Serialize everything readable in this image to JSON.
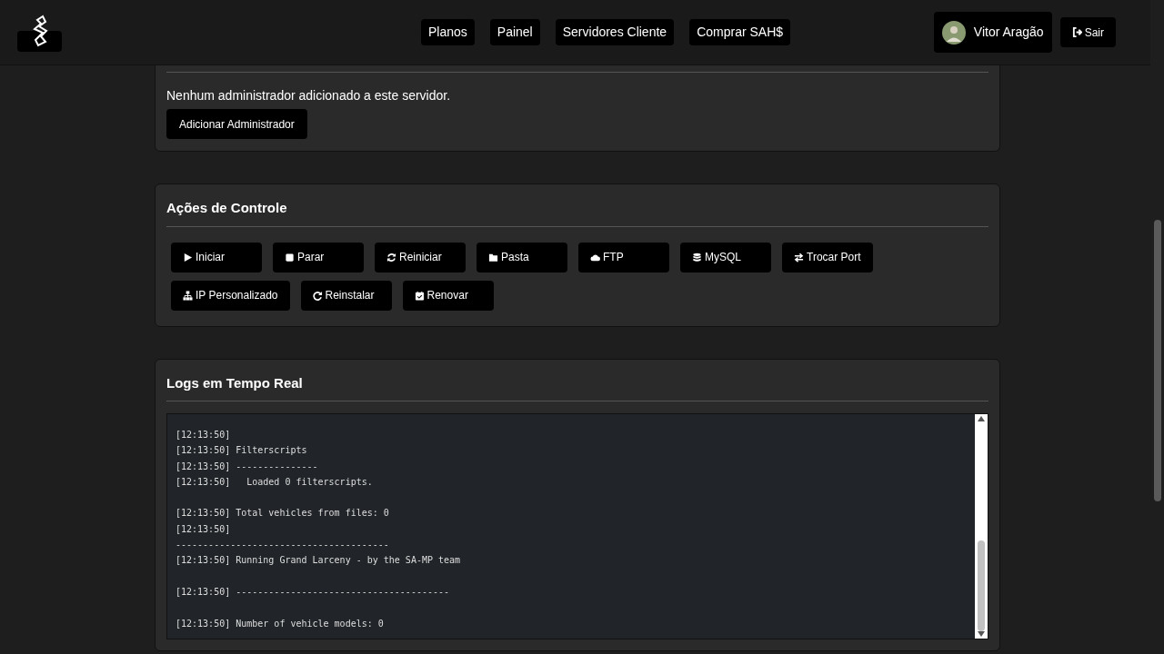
{
  "nav": {
    "links": [
      {
        "label": "Planos"
      },
      {
        "label": "Painel"
      },
      {
        "label": "Servidores Cliente"
      },
      {
        "label": "Comprar SAH$"
      }
    ],
    "user": {
      "name": "Vitor Aragão"
    },
    "logout": {
      "label": "Sair"
    }
  },
  "admins": {
    "message": "Nenhum administrador adicionado a este servidor.",
    "button": "Adicionar Administrador"
  },
  "controls": {
    "title": "Ações de Controle",
    "buttons": [
      {
        "label": "Iniciar",
        "kind": "play"
      },
      {
        "label": "Parar",
        "kind": "stop"
      },
      {
        "label": "Reiniciar",
        "kind": "sync"
      },
      {
        "label": "Pasta",
        "kind": "folder"
      },
      {
        "label": "FTP",
        "kind": "cloud"
      },
      {
        "label": "MySQL",
        "kind": "database"
      },
      {
        "label": "Trocar Port",
        "kind": "swap"
      },
      {
        "label": "IP Personalizado",
        "kind": "network"
      },
      {
        "label": "Reinstalar",
        "kind": "redo"
      },
      {
        "label": "Renovar",
        "kind": "calendar"
      }
    ]
  },
  "logs": {
    "title": "Logs em Tempo Real",
    "blocks": [
      [
        "[12:13:50]",
        "[12:13:50] Filterscripts",
        "[12:13:50] ---------------",
        "[12:13:50]   Loaded 0 filterscripts."
      ],
      [
        "[12:13:50] Total vehicles from files: 0",
        "[12:13:50]",
        "---------------------------------------",
        "[12:13:50] Running Grand Larceny - by the SA-MP team"
      ],
      [
        "[12:13:50] ---------------------------------------"
      ],
      [
        "[12:13:50] Number of vehicle models: 0"
      ]
    ]
  }
}
